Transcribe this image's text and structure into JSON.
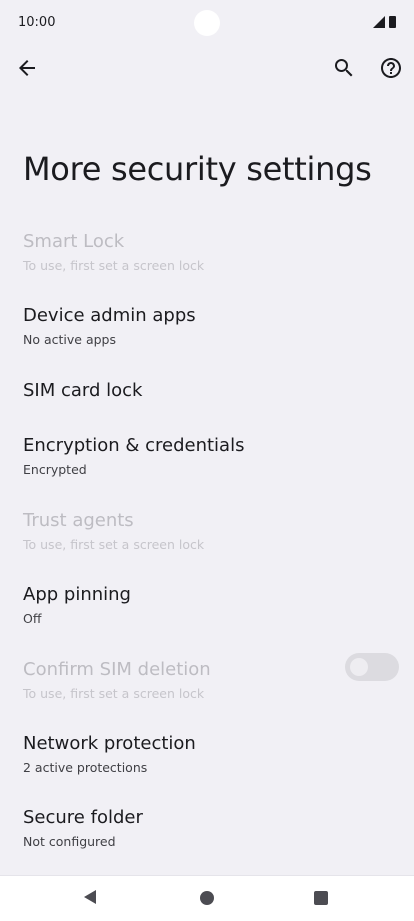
{
  "status_bar": {
    "time": "10:00"
  },
  "header": {
    "title": "More security settings"
  },
  "items": [
    {
      "title": "Smart Lock",
      "subtitle": "To use, first set a screen lock",
      "enabled": false
    },
    {
      "title": "Device admin apps",
      "subtitle": "No active apps",
      "enabled": true
    },
    {
      "title": "SIM card lock",
      "subtitle": "",
      "enabled": true
    },
    {
      "title": "Encryption & credentials",
      "subtitle": "Encrypted",
      "enabled": true
    },
    {
      "title": "Trust agents",
      "subtitle": "To use, first set a screen lock",
      "enabled": false
    },
    {
      "title": "App pinning",
      "subtitle": "Off",
      "enabled": true
    },
    {
      "title": "Confirm SIM deletion",
      "subtitle": "To use, first set a screen lock",
      "enabled": false,
      "toggle_on": false
    },
    {
      "title": "Network protection",
      "subtitle": "2 active protections",
      "enabled": true
    },
    {
      "title": "Secure folder",
      "subtitle": "Not configured",
      "enabled": true
    }
  ],
  "icons": {
    "back": "arrow-left-icon",
    "search": "search-icon",
    "help": "help-circle-icon"
  },
  "colors": {
    "background": "#f1f0f5",
    "text_primary": "#1b1b1f",
    "text_disabled": "#bdbcc2"
  }
}
